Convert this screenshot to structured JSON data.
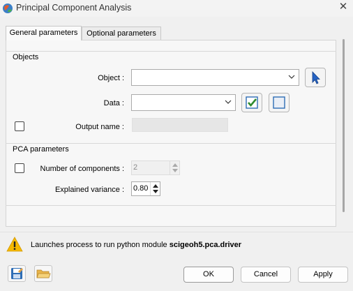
{
  "window": {
    "title": "Principal Component Analysis",
    "close_glyph": "✕"
  },
  "tabs": [
    {
      "label": "General parameters",
      "active": true
    },
    {
      "label": "Optional parameters",
      "active": false
    }
  ],
  "objects_group": {
    "title": "Objects",
    "object_label": "Object :",
    "object_value": "",
    "data_label": "Data :",
    "data_value": "",
    "output_name_label": "Output name :",
    "output_name_value": "",
    "output_name_checked": false
  },
  "pca_group": {
    "title": "PCA parameters",
    "num_components_label": "Number of components :",
    "num_components_value": "2",
    "num_components_checked": false,
    "explained_variance_label": "Explained variance :",
    "explained_variance_value": "0.80"
  },
  "info": {
    "message": "Launches process to run python module ",
    "module": "scigeoh5.pca.driver"
  },
  "footer": {
    "ok": "OK",
    "cancel": "Cancel",
    "apply": "Apply"
  },
  "icons": {
    "app": "sphere-icon",
    "select": "cursor-pick-icon",
    "check_all": "check-all-icon",
    "uncheck_all": "uncheck-all-icon",
    "warning": "warning-icon",
    "save": "save-icon",
    "open": "folder-open-icon"
  },
  "colors": {
    "accent": "#2563c4",
    "warning": "#f5b800",
    "check_green": "#2e8b2e"
  }
}
